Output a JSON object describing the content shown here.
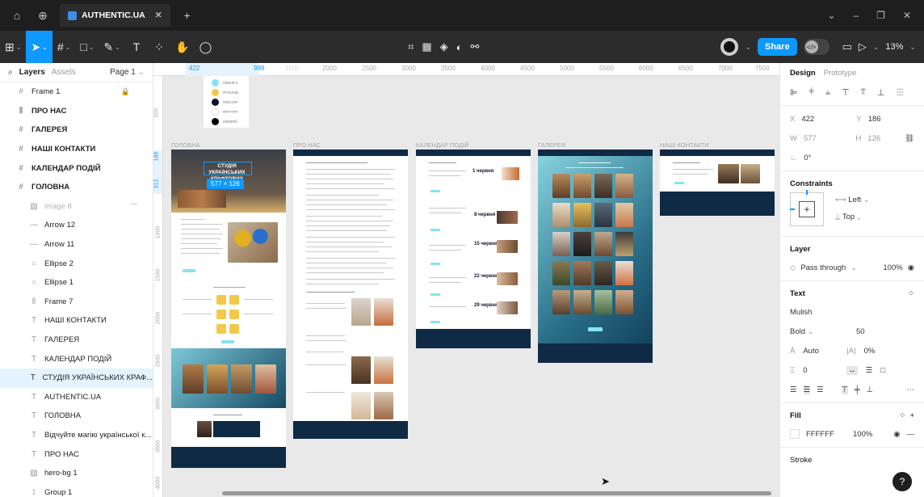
{
  "titlebar": {
    "tab_title": "AUTHENTIC.UA",
    "tab_close": "✕",
    "new_tab": "+"
  },
  "toolbar": {
    "share": "Share",
    "zoom": "13%"
  },
  "layers_panel": {
    "tab_layers": "Layers",
    "tab_assets": "Assets",
    "page": "Page 1",
    "items": [
      {
        "label": "Frame 1",
        "icon": "#"
      },
      {
        "label": "ПРО НАС",
        "icon": "⦀"
      },
      {
        "label": "ГАЛЕРЕЯ",
        "icon": "#"
      },
      {
        "label": "НАШІ КОНТАКТИ",
        "icon": "#"
      },
      {
        "label": "КАЛЕНДАР ПОДІЙ",
        "icon": "#"
      },
      {
        "label": "ГОЛОВНА",
        "icon": "#"
      },
      {
        "label": "image 8",
        "icon": "▨"
      },
      {
        "label": "Arrow 12",
        "icon": "—"
      },
      {
        "label": "Arrow 11",
        "icon": "—"
      },
      {
        "label": "Ellipse 2",
        "icon": "○"
      },
      {
        "label": "Ellipse 1",
        "icon": "○"
      },
      {
        "label": "Frame 7",
        "icon": "⦀"
      },
      {
        "label": "НАШІ КОНТАКТИ",
        "icon": "T"
      },
      {
        "label": "ГАЛЕРЕЯ",
        "icon": "T"
      },
      {
        "label": "КАЛЕНДАР ПОДІЙ",
        "icon": "T"
      },
      {
        "label": "СТУДІЯ УКРАЇНСЬКИХ КРАФ...",
        "icon": "T"
      },
      {
        "label": "AUTHENTIC.UA",
        "icon": "T"
      },
      {
        "label": "ГОЛОВНА",
        "icon": "T"
      },
      {
        "label": "Відчуйте магію української к...",
        "icon": "T"
      },
      {
        "label": "ПРО НАС",
        "icon": "T"
      },
      {
        "label": "hero-bg 1",
        "icon": "▨"
      },
      {
        "label": "Group 1",
        "icon": "⦂"
      }
    ]
  },
  "canvas": {
    "ruler_top": [
      "422",
      "999",
      "1500",
      "2000",
      "2500",
      "3000",
      "3500",
      "4000",
      "4500",
      "5000",
      "5500",
      "6000",
      "6500",
      "7000",
      "7500"
    ],
    "ruler_left": [
      "500",
      "186",
      "312",
      "1000",
      "1500",
      "2000",
      "2500",
      "3000",
      "3500",
      "4000"
    ],
    "frames": {
      "home": "ГОЛОВНА",
      "about": "ПРО НАС",
      "calendar": "КАЛЕНДАР ПОДІЙ",
      "gallery": "ГАЛЕРЕЯ",
      "contacts": "НАШІ КОНТАКТИ"
    },
    "swatches": [
      "#86E3F2",
      "#F2C94B",
      "#0D142F",
      "#FFFFFF",
      "#000000"
    ],
    "hero_text": "СТУДІЯ УКРАЇНСЬКИХ КРАФТОВИХ ВИРОБІВ",
    "size_badge": "577 × 126",
    "calendar_dates": [
      "1 червня",
      "8 червня",
      "15 червня",
      "22 червня",
      "29 червня"
    ]
  },
  "design_panel": {
    "tab_design": "Design",
    "tab_prototype": "Prototype",
    "x_label": "X",
    "x": "422",
    "y_label": "Y",
    "y": "186",
    "w_label": "W",
    "w": "577",
    "h_label": "H",
    "h": "126",
    "rotation": "0°",
    "constraints_title": "Constraints",
    "constraint_h": "Left",
    "constraint_v": "Top",
    "layer_title": "Layer",
    "blend": "Pass through",
    "opacity": "100%",
    "text_title": "Text",
    "font_family": "Mulish",
    "font_weight": "Bold",
    "font_size": "50",
    "line_height": "Auto",
    "letter_spacing": "0%",
    "paragraph_spacing": "0",
    "fill_title": "Fill",
    "fill_hex": "FFFFFF",
    "fill_opacity": "100%",
    "stroke_title": "Stroke"
  },
  "help": "?"
}
